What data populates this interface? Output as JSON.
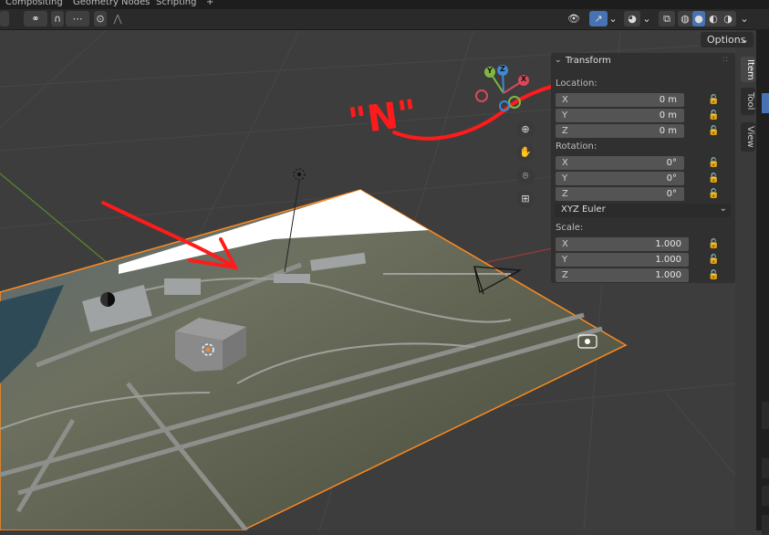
{
  "workspace_tabs": [
    "Compositing",
    "Geometry Nodes",
    "Scripting",
    "+"
  ],
  "header": {
    "options_label": "Options"
  },
  "gizmo": {
    "axis_x": "X",
    "axis_y": "Y",
    "axis_z": "Z"
  },
  "nav_icons": [
    "zoom-icon",
    "hand-pan-icon",
    "camera-icon",
    "grid-ortho-icon"
  ],
  "n_panel": {
    "title": "Transform",
    "location_label": "Location:",
    "location": [
      {
        "axis": "X",
        "value": "0 m"
      },
      {
        "axis": "Y",
        "value": "0 m"
      },
      {
        "axis": "Z",
        "value": "0 m"
      }
    ],
    "rotation_label": "Rotation:",
    "rotation": [
      {
        "axis": "X",
        "value": "0°"
      },
      {
        "axis": "Y",
        "value": "0°"
      },
      {
        "axis": "Z",
        "value": "0°"
      }
    ],
    "rotation_mode": "XYZ Euler",
    "scale_label": "Scale:",
    "scale": [
      {
        "axis": "X",
        "value": "1.000"
      },
      {
        "axis": "Y",
        "value": "1.000"
      },
      {
        "axis": "Z",
        "value": "1.000"
      }
    ]
  },
  "side_tabs": [
    "Item",
    "Tool",
    "View"
  ],
  "annotation": {
    "text": "\"N\"",
    "color": "#ff0000"
  },
  "colors": {
    "active_accent": "#4772b3",
    "selection_outline": "#ff8a1e"
  }
}
